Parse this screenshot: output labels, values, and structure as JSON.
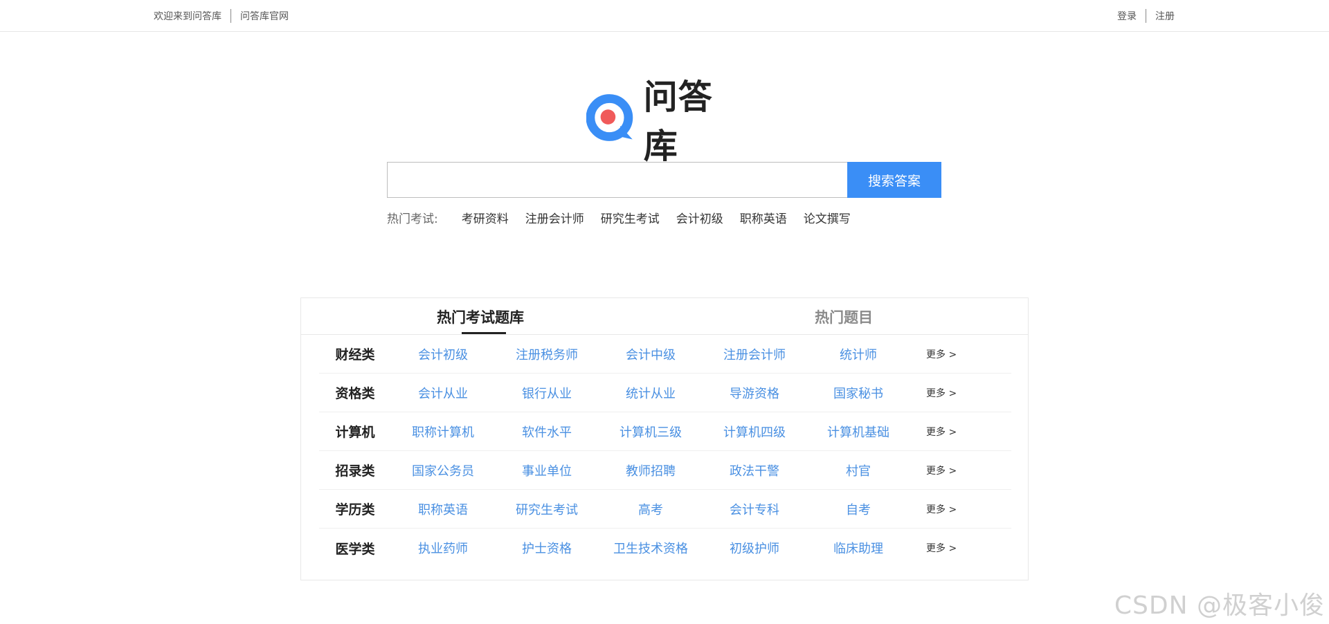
{
  "topbar": {
    "welcome": "欢迎来到问答库",
    "official": "问答库官网",
    "login": "登录",
    "register": "注册"
  },
  "logo": {
    "text": "问答库",
    "colors": {
      "blue": "#3a8ef6",
      "red": "#f05a5a"
    }
  },
  "search": {
    "value": "",
    "placeholder": "",
    "button": "搜索答案"
  },
  "hot": {
    "label": "热门考试:",
    "items": [
      "考研资料",
      "注册会计师",
      "研究生考试",
      "会计初级",
      "职称英语",
      "论文撰写"
    ]
  },
  "tabs": {
    "active": "热门考试题库",
    "inactive": "热门题目"
  },
  "categories": [
    {
      "name": "财经类",
      "items": [
        "会计初级",
        "注册税务师",
        "会计中级",
        "注册会计师",
        "统计师"
      ],
      "more": "更多 >"
    },
    {
      "name": "资格类",
      "items": [
        "会计从业",
        "银行从业",
        "统计从业",
        "导游资格",
        "国家秘书"
      ],
      "more": "更多 >"
    },
    {
      "name": "计算机",
      "items": [
        "职称计算机",
        "软件水平",
        "计算机三级",
        "计算机四级",
        "计算机基础"
      ],
      "more": "更多 >"
    },
    {
      "name": "招录类",
      "items": [
        "国家公务员",
        "事业单位",
        "教师招聘",
        "政法干警",
        "村官"
      ],
      "more": "更多 >"
    },
    {
      "name": "学历类",
      "items": [
        "职称英语",
        "研究生考试",
        "高考",
        "会计专科",
        "自考"
      ],
      "more": "更多 >"
    },
    {
      "name": "医学类",
      "items": [
        "执业药师",
        "护士资格",
        "卫生技术资格",
        "初级护师",
        "临床助理"
      ],
      "more": "更多 >"
    }
  ],
  "watermark": "CSDN @极客小俊"
}
